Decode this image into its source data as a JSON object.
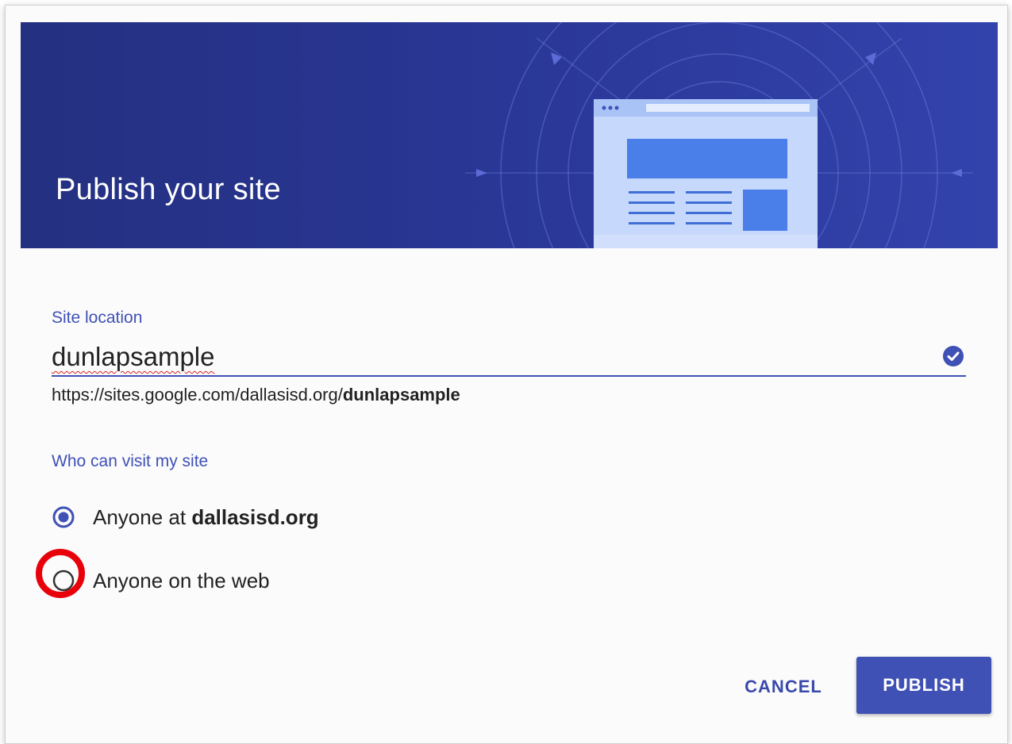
{
  "dialog": {
    "title": "Publish your site"
  },
  "site_location": {
    "label": "Site location",
    "value": "dunlapsample",
    "url_prefix": "https://sites.google.com/dallasisd.org/",
    "url_name": "dunlapsample",
    "valid_icon": "check-circle-icon"
  },
  "visibility": {
    "label": "Who can visit my site",
    "options": [
      {
        "prefix": "Anyone at ",
        "bold": "dallasisd.org",
        "selected": true
      },
      {
        "prefix": "Anyone on the web",
        "bold": "",
        "selected": false
      }
    ]
  },
  "actions": {
    "cancel_label": "CANCEL",
    "publish_label": "PUBLISH"
  },
  "colors": {
    "header_bg": "#283593",
    "accent": "#3f51b5",
    "highlight": "#e8000b"
  }
}
